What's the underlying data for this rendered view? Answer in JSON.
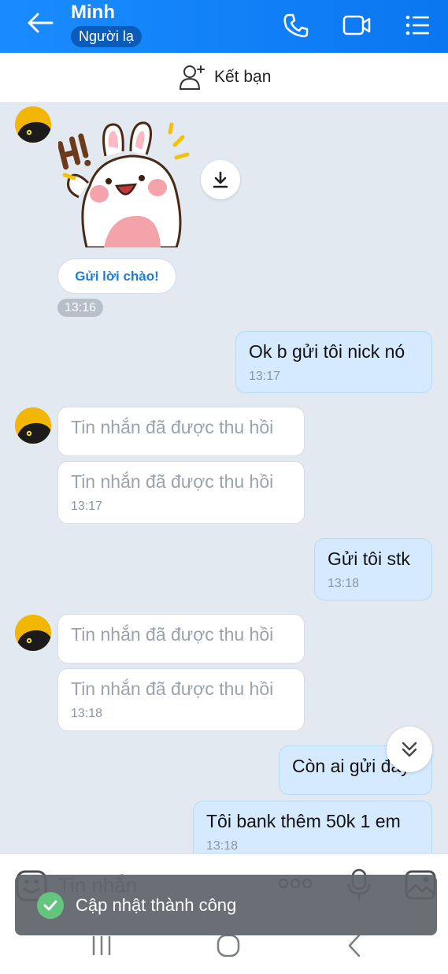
{
  "header": {
    "contact_name": "Minh",
    "badge": "Người lạ"
  },
  "add_friend": {
    "label": "Kết bạn"
  },
  "greeting": {
    "button_label": "Gửi lời chào!",
    "time": "13:16"
  },
  "messages": [
    {
      "side": "me",
      "text": "Ok b gửi tôi nick nó",
      "time": "13:17"
    },
    {
      "side": "them",
      "text": "Tin nhắn đã được thu hồi",
      "time": ""
    },
    {
      "side": "them",
      "text": "Tin nhắn đã được thu hồi",
      "time": "13:17"
    },
    {
      "side": "me",
      "text": "Gửi tôi stk",
      "time": "13:18"
    },
    {
      "side": "them",
      "text": "Tin nhắn đã được thu hồi",
      "time": ""
    },
    {
      "side": "them",
      "text": "Tin nhắn đã được thu hồi",
      "time": "13:18"
    },
    {
      "side": "me",
      "text": "Còn ai gửi đây",
      "time": ""
    },
    {
      "side": "me",
      "text": "Tôi bank thêm 50k 1 em",
      "time": "13:18"
    }
  ],
  "composer": {
    "placeholder": "Tin nhắn"
  },
  "toast": {
    "text": "Cập nhật thành công"
  },
  "colors": {
    "header": "#0a76f0",
    "my_bubble": "#d5eafe",
    "background": "#e2e9f1",
    "toast_check": "#64c67c"
  }
}
